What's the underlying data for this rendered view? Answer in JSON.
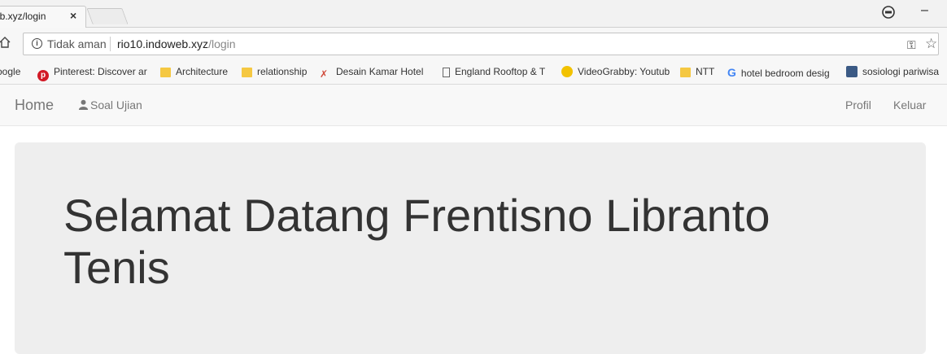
{
  "browser": {
    "tab_title": "eb.xyz/login",
    "tab_close": "×",
    "minimize": "–",
    "security_label": "Tidak aman",
    "url_host": "rio10.indoweb.xyz",
    "url_path": "/login",
    "bookmarks": [
      {
        "label": "oogle",
        "icon": "google-icon"
      },
      {
        "label": "Pinterest: Discover ar",
        "icon": "pinterest-icon"
      },
      {
        "label": "Architecture",
        "icon": "folder-icon"
      },
      {
        "label": "relationship",
        "icon": "folder-icon"
      },
      {
        "label": "Desain Kamar Hotel ",
        "icon": "feather-icon"
      },
      {
        "label": "England Rooftop & T",
        "icon": "page-icon"
      },
      {
        "label": "VideoGrabby: Youtub",
        "icon": "videograbby-icon"
      },
      {
        "label": "NTT",
        "icon": "folder-icon"
      },
      {
        "label": "hotel bedroom desig",
        "icon": "google-icon"
      },
      {
        "label": "sosiologi pariwisa",
        "icon": "image-icon"
      }
    ]
  },
  "navbar": {
    "brand": "Home",
    "soal_ujian": "Soal Ujian",
    "profil": "Profil",
    "keluar": "Keluar"
  },
  "jumbotron": {
    "title": "Selamat Datang Frentisno Libranto Tenis"
  },
  "colors": {
    "navbar_bg": "#f8f8f8",
    "jumbotron_bg": "#eeeeee",
    "nav_text": "#777777",
    "title_text": "#333333"
  }
}
